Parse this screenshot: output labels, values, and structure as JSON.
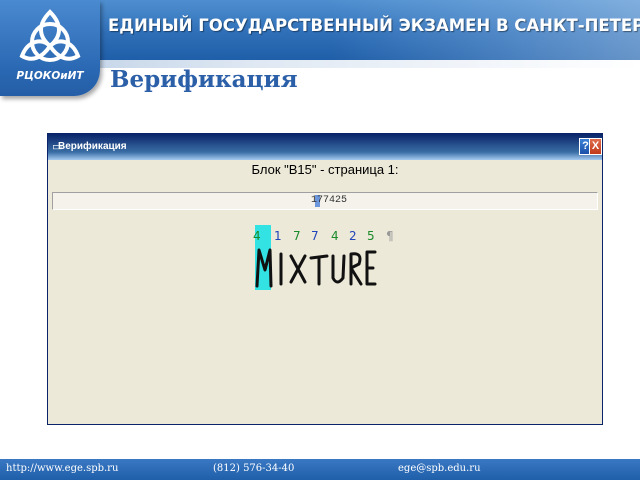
{
  "header": {
    "title": "ЕДИНЫЙ ГОСУДАРСТВЕННЫЙ ЭКЗАМЕН В САНКТ-ПЕТЕРБУРГЕ",
    "logo_text": "РЦОКОиИТ"
  },
  "page_title": "Верификация",
  "window": {
    "title": "Верификация",
    "help_label": "?",
    "close_label": "X",
    "block_label": "Блок \"В15\" - страница 1:",
    "field_value": "177425",
    "digits": [
      "4",
      "1",
      "7",
      "7",
      "4",
      "2",
      "5",
      "¶"
    ],
    "handwriting": [
      "M",
      "I",
      "X",
      "T",
      "U",
      "R",
      "E"
    ]
  },
  "footer": {
    "url": "http://www.ege.spb.ru",
    "phone": "(812) 576-34-40",
    "email": "ege@spb.edu.ru"
  },
  "colors": {
    "brand_blue": "#2b69b4",
    "highlight_cyan": "#33e3e3",
    "digit_green": "#1a8a2a",
    "digit_blue": "#2244bb"
  }
}
